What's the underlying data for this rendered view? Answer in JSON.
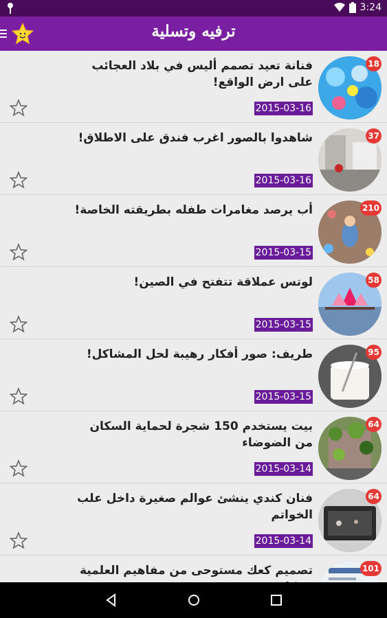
{
  "status_bar": {
    "time": "3:24",
    "icons": [
      "pin-icon",
      "wifi-icon",
      "battery-icon"
    ]
  },
  "app_bar": {
    "title": "ترفيه وتسلية",
    "icons": [
      "menu-icon",
      "star-logo-icon"
    ]
  },
  "colors": {
    "app_bar": "#7b1fa2",
    "status_bar": "#4a0a5a",
    "date_badge": "#6a1b9a",
    "count_badge": "#e53935"
  },
  "articles": [
    {
      "headline": "فنانة تعيد تصمم أليس في بلاد العجائب على ارض الواقع!",
      "date": "2015-03-16",
      "count": "18"
    },
    {
      "headline": "شاهدوا بالصور اغرب فندق على الاطلاق!",
      "date": "2015-03-16",
      "count": "37"
    },
    {
      "headline": "أب يرصد مغامرات طفله بطريقته الخاصة!",
      "date": "2015-03-15",
      "count": "210"
    },
    {
      "headline": "لوتس عملاقة تتفتح في الصين!",
      "date": "2015-03-15",
      "count": "58"
    },
    {
      "headline": "طريف: صور أفكار رهيبة لحل المشاكل!",
      "date": "2015-03-15",
      "count": "95"
    },
    {
      "headline": "بيت يستخدم 150 شجرة لحماية السكان من الضوضاء",
      "date": "2015-03-14",
      "count": "64"
    },
    {
      "headline": "فنان كندي ينشئ عوالم صغيرة داخل علب الخواتم",
      "date": "2015-03-14",
      "count": "64"
    },
    {
      "headline": "تصميم كعك مستوحى من مفاهيم العلمية بشكل",
      "date": "",
      "count": "101"
    }
  ],
  "nav_bar": {
    "icons": [
      "back-icon",
      "home-icon",
      "recents-icon"
    ]
  }
}
